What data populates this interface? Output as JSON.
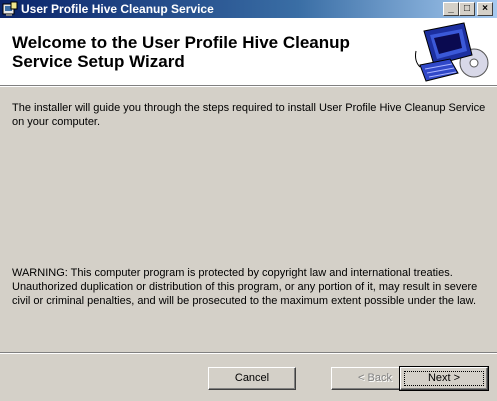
{
  "window": {
    "title": "User Profile Hive Cleanup Service",
    "minimize_glyph": "_",
    "maximize_glyph": "□",
    "close_glyph": "×"
  },
  "header": {
    "title": "Welcome to the User Profile Hive Cleanup Service Setup Wizard",
    "icon": "computer-setup-icon"
  },
  "content": {
    "intro": "The installer will guide you through the steps required to install User Profile Hive Cleanup Service on your computer.",
    "warning": "WARNING: This computer program is protected by copyright law and international treaties. Unauthorized duplication or distribution of this program, or any portion of it, may result in severe civil or criminal penalties, and will be prosecuted to the maximum extent possible under the law."
  },
  "buttons": {
    "cancel": "Cancel",
    "back": "< Back",
    "next": "Next >"
  },
  "state": {
    "back_enabled": false,
    "focused_button": "next"
  }
}
